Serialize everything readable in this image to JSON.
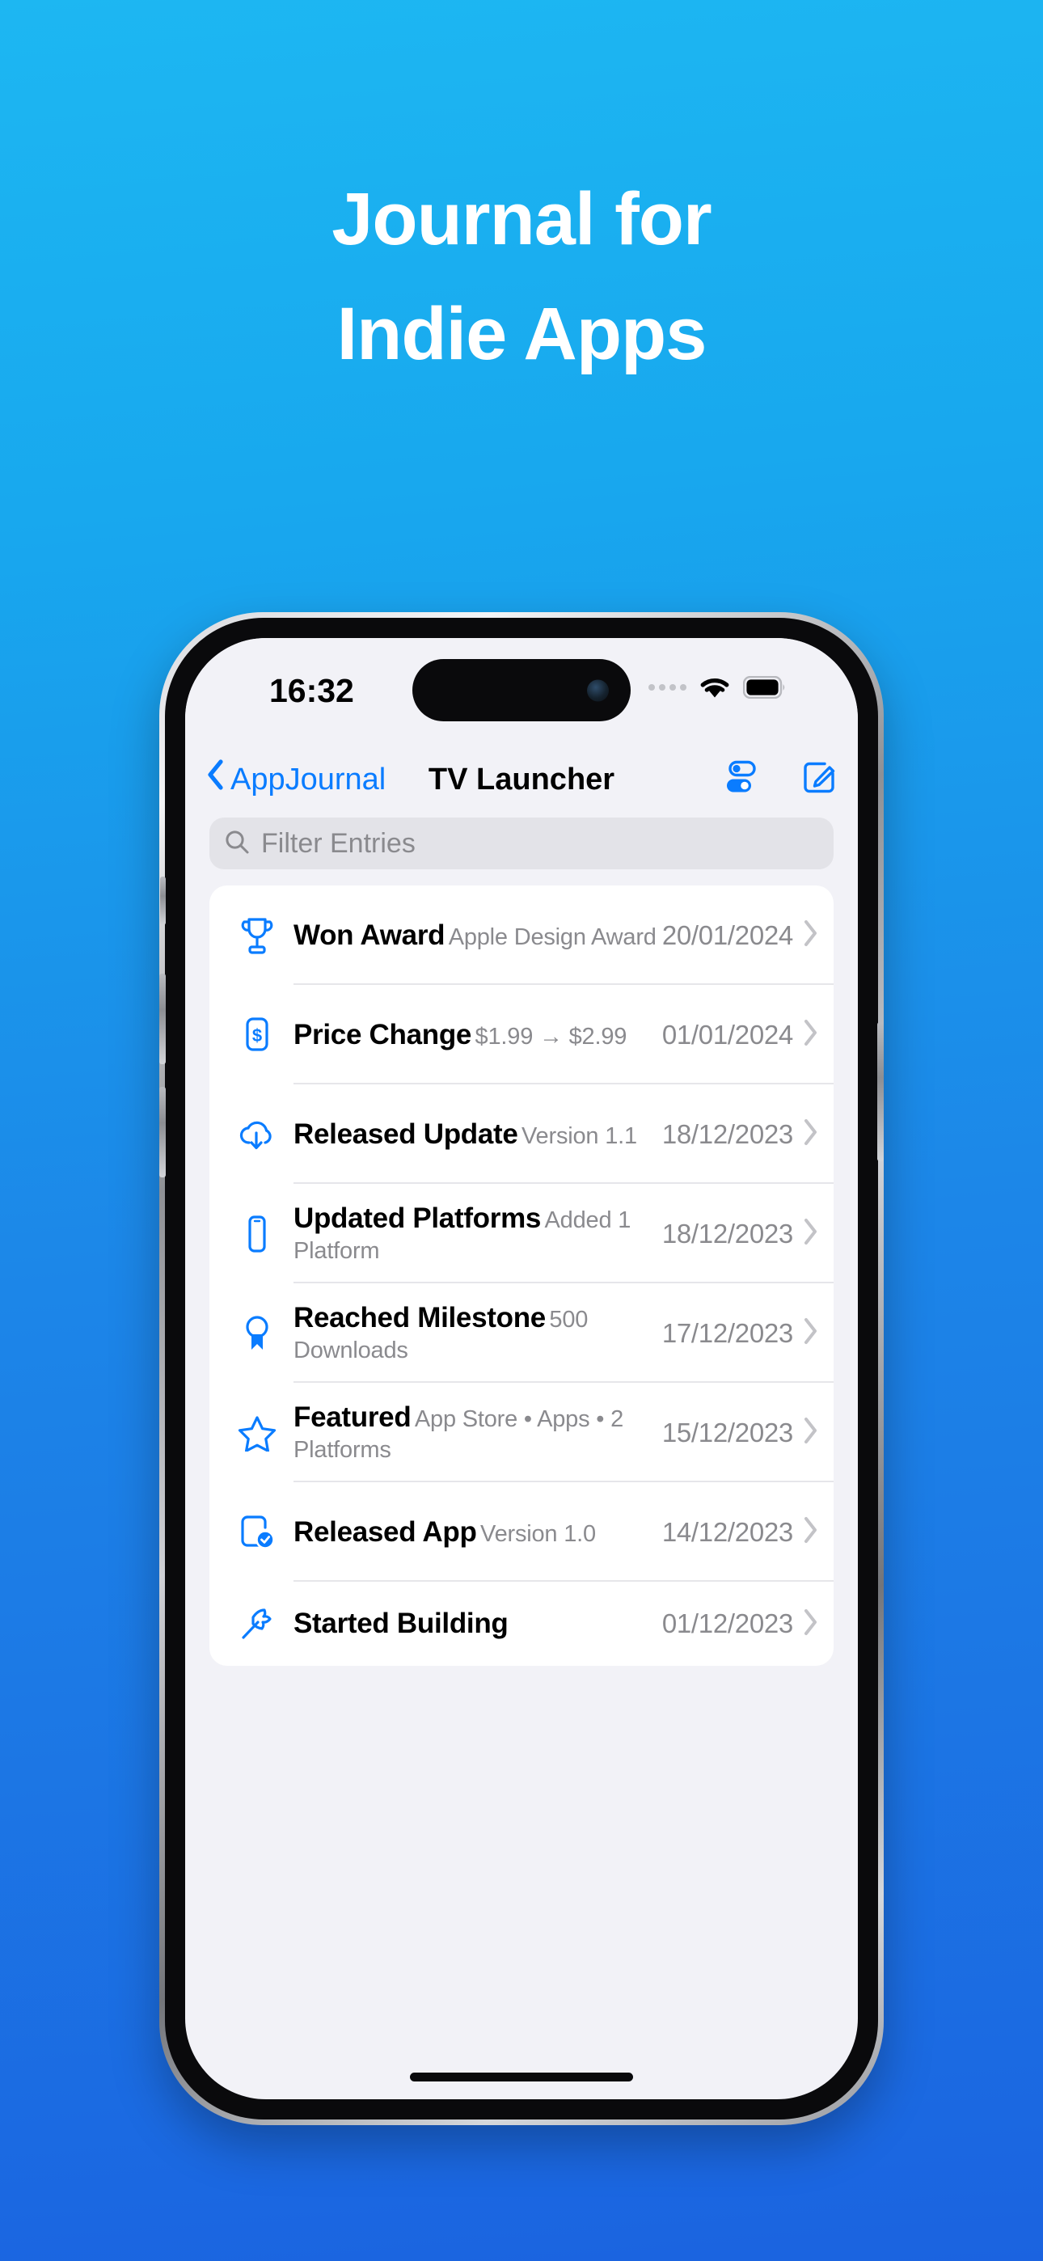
{
  "promo": {
    "headline_line1": "Journal for",
    "headline_line2": "Indie Apps",
    "background_top": "#1DB7F2",
    "background_bottom": "#1B63E0",
    "text_color": "#FFFFFF"
  },
  "status_bar": {
    "time": "16:32",
    "cellular_icon": "cellular-dots-icon",
    "wifi_icon": "wifi-icon",
    "battery_icon": "battery-full-icon"
  },
  "nav": {
    "back_icon": "chevron-left-icon",
    "back_label": "AppJournal",
    "title": "TV Launcher",
    "filter_icon": "sliders-toggle-icon",
    "compose_icon": "compose-square-pencil-icon",
    "accent_color": "#0A7CFF"
  },
  "search": {
    "icon": "search-icon",
    "placeholder": "Filter Entries",
    "value": ""
  },
  "entries": [
    {
      "icon": "trophy-icon",
      "title": "Won Award",
      "subtitle": "Apple Design Award",
      "date": "20/01/2024",
      "chevron": "chevron-right-icon"
    },
    {
      "icon": "dollar-sign-square-icon",
      "title": "Price Change",
      "subtitle": "$1.99 → $2.99",
      "date": "01/01/2024",
      "chevron": "chevron-right-icon"
    },
    {
      "icon": "cloud-download-icon",
      "title": "Released Update",
      "subtitle": "Version 1.1",
      "date": "18/12/2023",
      "chevron": "chevron-right-icon"
    },
    {
      "icon": "iphone-icon",
      "title": "Updated Platforms",
      "subtitle": "Added 1 Platform",
      "date": "18/12/2023",
      "chevron": "chevron-right-icon"
    },
    {
      "icon": "rosette-medal-icon",
      "title": "Reached Milestone",
      "subtitle": "500 Downloads",
      "date": "17/12/2023",
      "chevron": "chevron-right-icon"
    },
    {
      "icon": "star-icon",
      "title": "Featured",
      "subtitle": "App Store • Apps • 2 Platforms",
      "date": "15/12/2023",
      "chevron": "chevron-right-icon"
    },
    {
      "icon": "app-badge-checkmark-icon",
      "title": "Released App",
      "subtitle": "Version 1.0",
      "date": "14/12/2023",
      "chevron": "chevron-right-icon"
    },
    {
      "icon": "hammer-icon",
      "title": "Started Building",
      "subtitle": "",
      "date": "01/12/2023",
      "chevron": "chevron-right-icon"
    }
  ]
}
